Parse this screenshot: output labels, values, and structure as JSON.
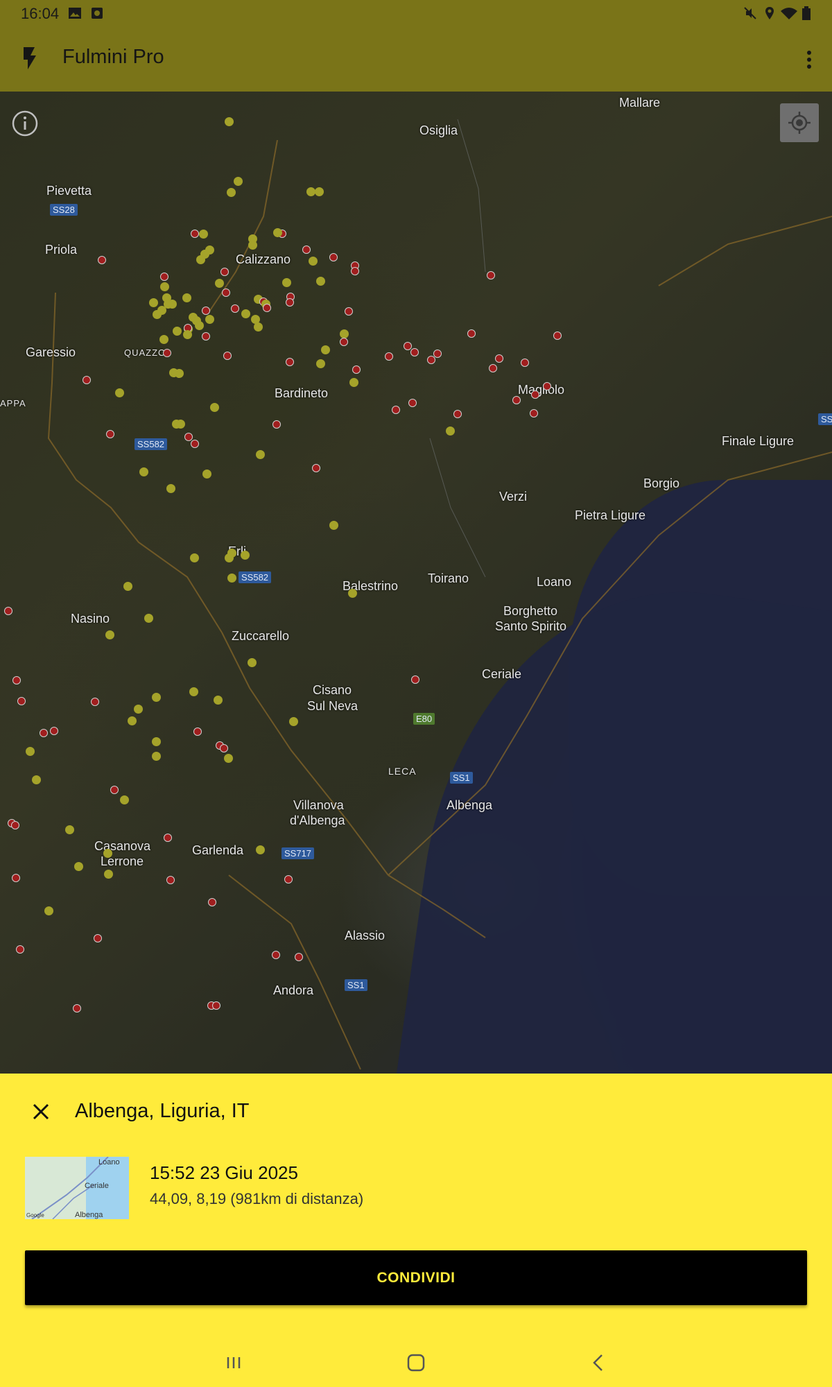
{
  "status_bar": {
    "time": "16:04",
    "left_icons": [
      "image-icon",
      "camera-icon"
    ],
    "right_icons": [
      "mute-icon",
      "location-icon",
      "wifi-icon",
      "battery-icon"
    ]
  },
  "app_bar": {
    "title": "Fulmini Pro",
    "icon": "bolt-icon",
    "menu_icon": "more-vert-icon",
    "color": "#7a7418"
  },
  "map": {
    "controls": [
      "info-icon",
      "my-location-icon"
    ],
    "place_labels": [
      "Mallare",
      "Osiglia",
      "Pievetta",
      "Priola",
      "Calizzano",
      "Garessio",
      "QUAZZO",
      "Bardineto",
      "Magliolo",
      "Finale Ligure",
      "Borgio",
      "Verzi",
      "Pietra Ligure",
      "APPA",
      "Erli",
      "Balestrino",
      "Toirano",
      "Loano",
      "Nasino",
      "Zuccarello",
      "Borghetto",
      "Santo Spirito",
      "Ceriale",
      "Cisano",
      "Sul Neva",
      "LECA",
      "Albenga",
      "Villanova",
      "d'Albenga",
      "Casanova",
      "Lerrone",
      "Garlenda",
      "Alassio",
      "Andora"
    ],
    "road_labels": [
      "SS28",
      "SS582",
      "SS582",
      "E80",
      "SS1",
      "SS717",
      "SS1",
      "SS"
    ],
    "strike_colors": {
      "recent": "#a01e1e",
      "older": "#a5a32a"
    }
  },
  "sheet": {
    "location": "Albenga, Liguria, IT",
    "datetime": "15:52 23 Giu 2025",
    "coords": "44,09, 8,19 (981km di distanza)",
    "share_label": "CONDIVIDI",
    "thumb_labels": [
      "Loano",
      "Ceriale",
      "Albenga",
      "Google"
    ],
    "background": "#ffeb3b"
  },
  "nav_bar": {
    "icons": [
      "recents-icon",
      "home-icon",
      "back-icon"
    ]
  }
}
